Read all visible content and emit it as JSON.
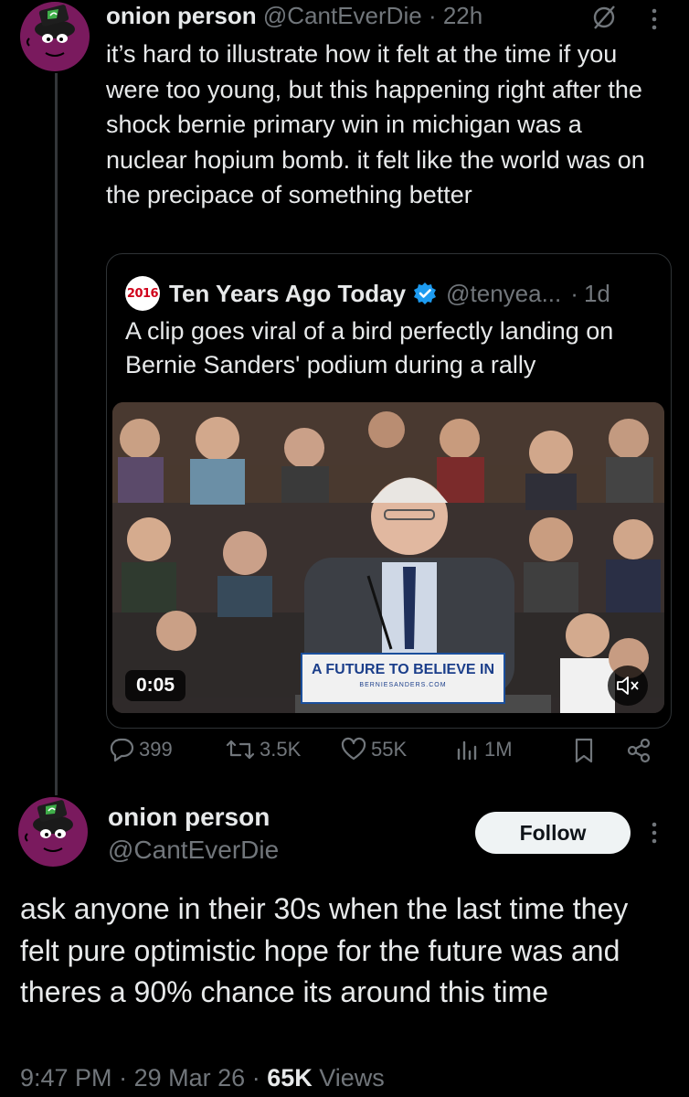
{
  "reply_tweet": {
    "author_name": "onion person",
    "handle": "@CantEverDie",
    "separator": "·",
    "time": "22h",
    "text": "it’s hard to illustrate how it felt at the time if you were too young, but this happening right after the shock bernie primary win in michigan was a nuclear hopium bomb.  it felt like the world was on the precipace of something better",
    "icons": [
      "grok-icon",
      "more-icon"
    ]
  },
  "quoted_tweet": {
    "logo_text": "2016",
    "author_name": "Ten Years Ago Today",
    "handle": "@tenyea...",
    "separator": "·",
    "time": "1d",
    "text": "A clip goes viral of a bird perfectly landing on Bernie Sanders' podium during a rally",
    "video": {
      "duration": "0:05",
      "podium_sign": "A FUTURE TO BELIEVE IN",
      "podium_url": "BERNIESANDERS.COM",
      "muted": true
    }
  },
  "action_bar": {
    "replies": "399",
    "reposts": "3.5K",
    "likes": "55K",
    "views": "1M"
  },
  "main_tweet": {
    "author_name": "onion person",
    "handle": "@CantEverDie",
    "follow_label": "Follow",
    "text": "ask anyone in their 30s when the last time they felt pure optimistic hope for the future was and theres a 90% chance its around this time",
    "time": "9:47 PM",
    "date": "29 Mar 26",
    "views_count": "65K",
    "views_label": "Views",
    "separator": "·"
  },
  "colors": {
    "background": "#000000",
    "text": "#e7e9ea",
    "muted": "#71767b",
    "border": "#2f3336",
    "verified": "#1d9bf0",
    "avatar": "#7a1a5e"
  }
}
